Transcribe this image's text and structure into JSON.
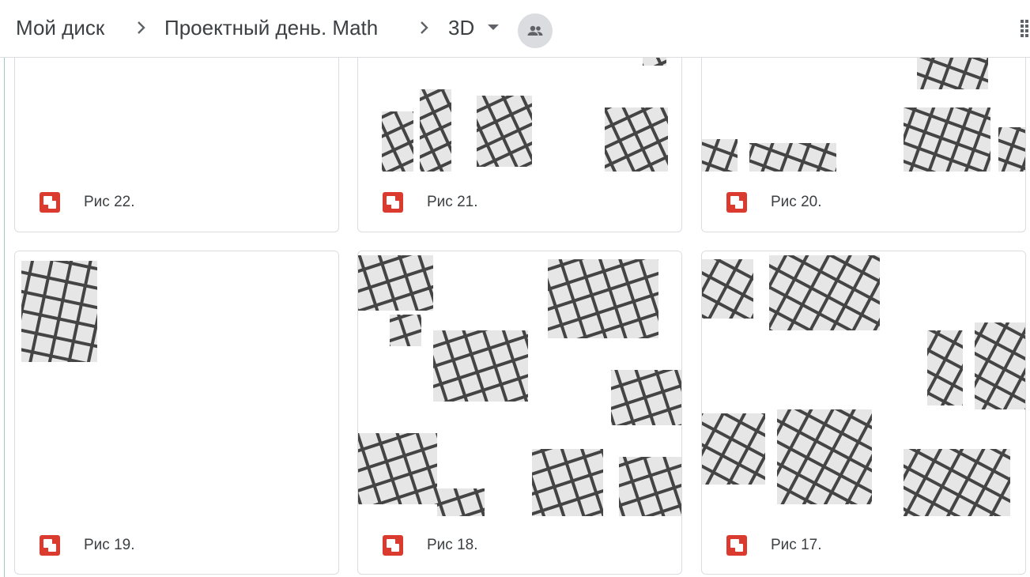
{
  "breadcrumb": {
    "items": [
      "Мой диск",
      "Проектный день. Math",
      "3D"
    ]
  },
  "icons": {
    "separator": "chevron-right-icon",
    "dropdown": "arrow-drop-down-icon",
    "shared": "people-icon",
    "apps": "grid-view-icon",
    "file": "image-file-icon"
  },
  "colors": {
    "file_icon": "#db3a2e",
    "border": "#dadce0",
    "text": "#3c4043"
  },
  "files": [
    {
      "name": "Рис 22."
    },
    {
      "name": "Рис 21."
    },
    {
      "name": "Рис 20."
    },
    {
      "name": "Рис 19."
    },
    {
      "name": "Рис 18."
    },
    {
      "name": "Рис 17."
    }
  ]
}
